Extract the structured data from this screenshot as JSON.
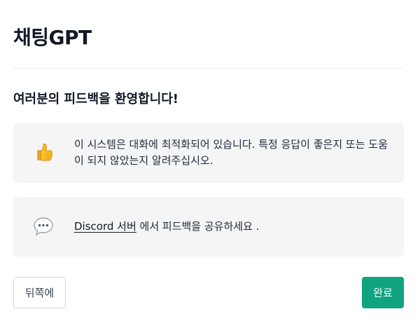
{
  "header": {
    "title": "채팅GPT"
  },
  "feedback": {
    "heading": "여러분의 피드백을 환영합니다!",
    "cards": [
      {
        "icon": "thumbs-up-icon",
        "text": "이 시스템은 대화에 최적화되어 있습니다. 특정 응답이 좋은지 또는 도움이 되지 않았는지 알려주십시오."
      },
      {
        "icon": "speech-bubble-icon",
        "link_text": "Discord 서버",
        "text": " 에서 피드백을 공유하세요 ."
      }
    ]
  },
  "footer": {
    "back_label": "뒤쪽에",
    "done_label": "완료"
  },
  "colors": {
    "accent": "#10a37f",
    "card_background": "#f5f5f6",
    "text": "#111827"
  }
}
